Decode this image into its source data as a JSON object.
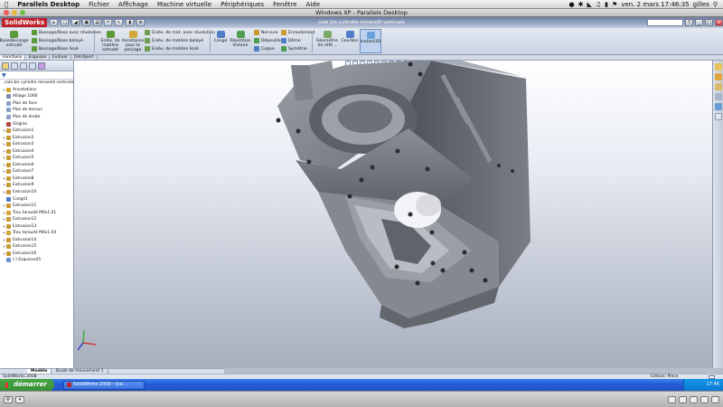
{
  "mac_menubar": {
    "app": "Parallels Desktop",
    "menus": [
      "Fichier",
      "Affichage",
      "Machine virtuelle",
      "Périphériques",
      "Fenêtre",
      "Aide"
    ],
    "clock": "ven. 2 mars  17:46:35",
    "user": "gilles"
  },
  "parallels_window_title": "Windows XP - Parallels Desktop",
  "solidworks": {
    "logo": "SolidWorks",
    "doc_title": "cale bis cylindre minarelli verticale",
    "search_placeholder": "",
    "ribbon": {
      "large_buttons": [
        {
          "label": "Base/Bossage extrudé",
          "color": "#5c9a3c"
        },
        {
          "label": "Enlèv. de matière extrudé",
          "color": "#5c9a3c"
        },
        {
          "label": "Assistance pour le perçage",
          "color": "#d5a638"
        },
        {
          "label": "Congé",
          "color": "#4f7ec6"
        },
        {
          "label": "Répétition linéaire",
          "color": "#4f9e4f"
        },
        {
          "label": "Géométrie de réfé...",
          "color": "#7aa96a"
        },
        {
          "label": "Courbes",
          "color": "#4f7ec6"
        },
        {
          "label": "Instant3D",
          "color": "#6aa2de"
        }
      ],
      "small_buttons": [
        {
          "label": "Bossage/Base avec révolution",
          "color": "#5c9a3c"
        },
        {
          "label": "Bossage/Base balayé",
          "color": "#5c9a3c"
        },
        {
          "label": "Bossage/Base lissé",
          "color": "#5c9a3c"
        },
        {
          "label": "Enlèv. de mat. avec révolution",
          "color": "#6f9e4f"
        },
        {
          "label": "Enlèv. de matière balayé",
          "color": "#6f9e4f"
        },
        {
          "label": "Enlèv. de matière lissé",
          "color": "#6f9e4f"
        },
        {
          "label": "Nervure",
          "color": "#c99b2f"
        },
        {
          "label": "Dépouille",
          "color": "#4f9e4f"
        },
        {
          "label": "Coque",
          "color": "#4f7ec6"
        },
        {
          "label": "Enroulement",
          "color": "#c99b2f"
        },
        {
          "label": "Dôme",
          "color": "#4f7ec6"
        },
        {
          "label": "Symétrie",
          "color": "#4f9e4f"
        }
      ]
    },
    "cm_tabs": [
      "Fonctions",
      "Esquisse",
      "Evaluer",
      "DimXpert"
    ],
    "tree_root": "cale bis cylindre minarelli verticale",
    "tree_items": [
      {
        "label": "Annotations",
        "color": "#d9a62f",
        "plus": true
      },
      {
        "label": "Alliage 1060",
        "color": "#7f8ea8",
        "plus": false
      },
      {
        "label": "Plan de face",
        "color": "#8aa0c8",
        "plus": false
      },
      {
        "label": "Plan de dessus",
        "color": "#8aa0c8",
        "plus": false
      },
      {
        "label": "Plan de droite",
        "color": "#8aa0c8",
        "plus": false
      },
      {
        "label": "Origine",
        "color": "#b04545",
        "plus": false
      },
      {
        "label": "Extrusion1",
        "color": "#c79a34",
        "plus": true
      },
      {
        "label": "Extrusion2",
        "color": "#c79a34",
        "plus": true
      },
      {
        "label": "Extrusion3",
        "color": "#c79a34",
        "plus": true
      },
      {
        "label": "Extrusion4",
        "color": "#c79a34",
        "plus": true
      },
      {
        "label": "Extrusion5",
        "color": "#c79a34",
        "plus": true
      },
      {
        "label": "Extrusion6",
        "color": "#c79a34",
        "plus": true
      },
      {
        "label": "Extrusion7",
        "color": "#c79a34",
        "plus": true
      },
      {
        "label": "Extrusion8",
        "color": "#c79a34",
        "plus": true
      },
      {
        "label": "Extrusion9",
        "color": "#c79a34",
        "plus": true
      },
      {
        "label": "Extrusion10",
        "color": "#c79a34",
        "plus": true
      },
      {
        "label": "Congé1",
        "color": "#4f7ec6",
        "plus": false
      },
      {
        "label": "Extrusion11",
        "color": "#c79a34",
        "plus": true
      },
      {
        "label": "Trou taraudé M6x1.01",
        "color": "#d5a638",
        "plus": true
      },
      {
        "label": "Extrusion12",
        "color": "#c79a34",
        "plus": true
      },
      {
        "label": "Extrusion13",
        "color": "#c79a34",
        "plus": true
      },
      {
        "label": "Trou taraudé M6x1.04",
        "color": "#d5a638",
        "plus": true
      },
      {
        "label": "Extrusion14",
        "color": "#c79a34",
        "plus": true
      },
      {
        "label": "Extrusion15",
        "color": "#c79a34",
        "plus": true
      },
      {
        "label": "Extrusion16",
        "color": "#c79a34",
        "plus": true
      },
      {
        "label": "(-) Esquisse45",
        "color": "#6a8fd0",
        "plus": false
      }
    ],
    "model_tabs": [
      "Modèle",
      "Etude de mouvement 1"
    ],
    "status_left": "SolidWorks 2008",
    "status_right": "Edition: Pièce"
  },
  "taskbar": {
    "start": "démarrer",
    "task": "SolidWorks 2008 - [ca...",
    "clock": "17:46"
  }
}
